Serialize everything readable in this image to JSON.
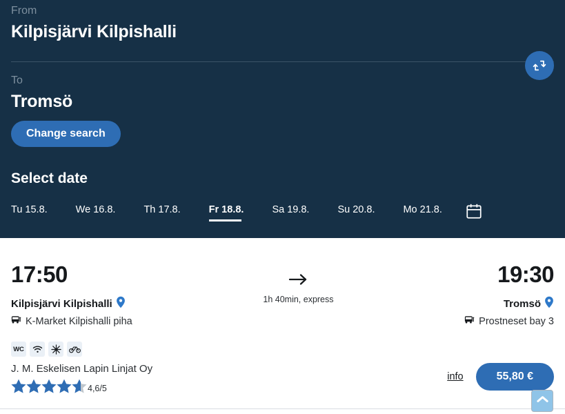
{
  "search": {
    "from_label": "From",
    "from_value": "Kilpisjärvi Kilpishalli",
    "to_label": "To",
    "to_value": "Tromsö",
    "change_search_label": "Change search",
    "swap_icon": "swap-vertical-icon"
  },
  "date_selector": {
    "title": "Select date",
    "calendar_icon": "calendar-icon",
    "dates": [
      {
        "label": "Tu 15.8.",
        "active": false
      },
      {
        "label": "We 16.8.",
        "active": false
      },
      {
        "label": "Th 17.8.",
        "active": false
      },
      {
        "label": "Fr 18.8.",
        "active": true
      },
      {
        "label": "Sa 19.8.",
        "active": false
      },
      {
        "label": "Su 20.8.",
        "active": false
      },
      {
        "label": "Mo 21.8.",
        "active": false
      }
    ]
  },
  "result": {
    "departure_time": "17:50",
    "departure_stop": "Kilpisjärvi Kilpishalli",
    "departure_platform": "K-Market Kilpishalli piha",
    "arrival_time": "19:30",
    "arrival_stop": "Tromsö",
    "arrival_platform": "Prostneset bay 3",
    "duration": "1h 40min, express",
    "arrow_icon": "arrow-right-icon",
    "pin_icon": "map-pin-icon",
    "bus_icon": "bus-icon",
    "amenities": [
      {
        "name": "wc-icon",
        "label": "WC"
      },
      {
        "name": "wifi-icon",
        "label": ""
      },
      {
        "name": "air-conditioning-icon",
        "label": ""
      },
      {
        "name": "bicycle-icon",
        "label": ""
      }
    ],
    "operator": "J. M. Eskelisen Lapin Linjat Oy",
    "rating_value": "4,6/5",
    "rating_stars": 4.6,
    "rating_max": 5,
    "info_label": "info",
    "price_label": "55,80 €"
  },
  "scroll_top": {
    "icon": "chevron-up-icon"
  },
  "colors": {
    "header_navy": "#163046",
    "accent_blue": "#2e6db4",
    "muted_label": "#7d8f9e",
    "star_blue": "#2f6db4",
    "star_empty": "#bfc6cc",
    "amenity_bg": "#eaf0f6",
    "scroll_top_bg": "#8fc4e8",
    "text_dark": "#16191c"
  }
}
